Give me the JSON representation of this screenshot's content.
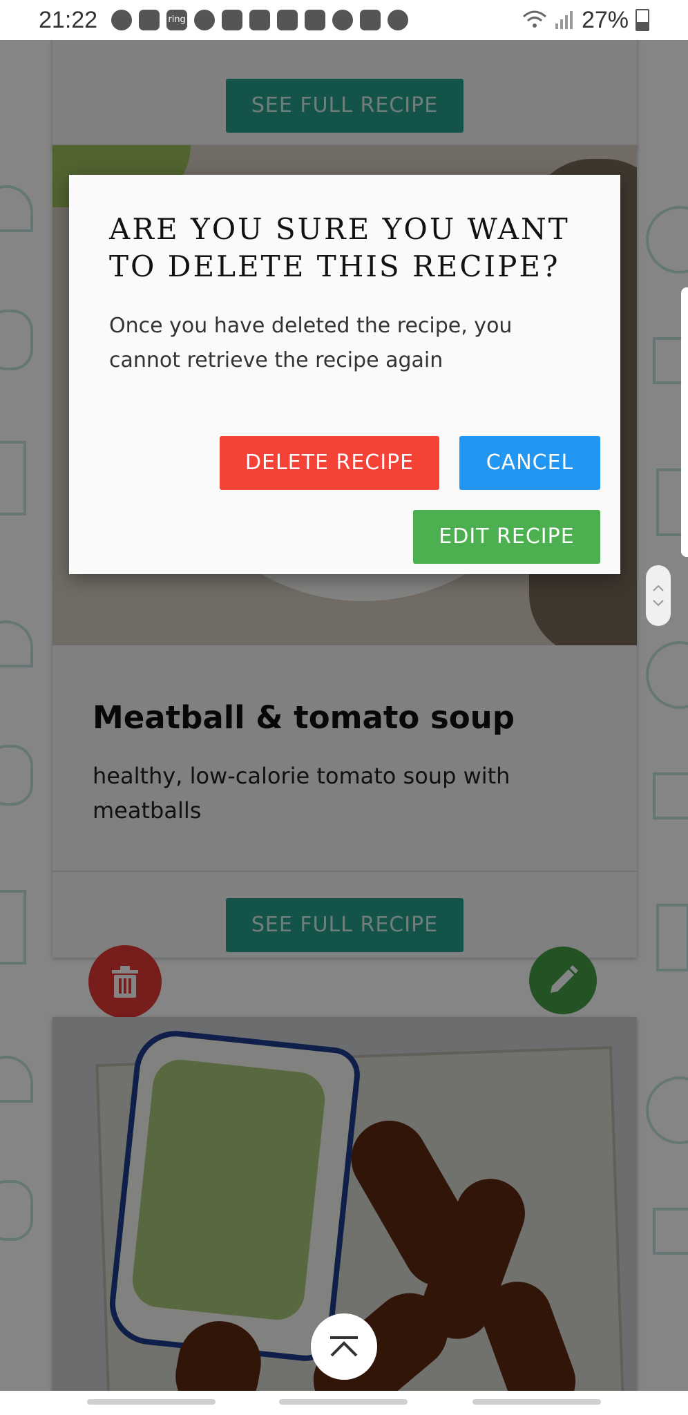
{
  "status_bar": {
    "time": "21:22",
    "notification_icons": [
      "facebook-icon",
      "shield-icon",
      "ring-icon",
      "chrome-icon",
      "twitch-icon",
      "mail-icon",
      "gmail-icon",
      "instagram-icon",
      "soccer-icon",
      "gallery-icon",
      "cloud-icon"
    ],
    "ring_label": "ring",
    "battery": "27%"
  },
  "cards": {
    "top": {
      "button": "SEE FULL RECIPE"
    },
    "meatball": {
      "title": "Meatball & tomato soup",
      "description": "healthy, low-calorie tomato soup with meatballs",
      "button": "SEE FULL RECIPE"
    }
  },
  "modal": {
    "title": "ARE YOU SURE YOU WANT TO DELETE THIS RECIPE?",
    "body": "Once you have deleted the recipe, you cannot retrieve the recipe again",
    "delete_label": "DELETE RECIPE",
    "cancel_label": "CANCEL",
    "edit_label": "EDIT RECIPE"
  },
  "colors": {
    "delete": "#f44336",
    "cancel": "#2196f3",
    "edit": "#4caf50",
    "see_recipe": "#25a08f"
  }
}
